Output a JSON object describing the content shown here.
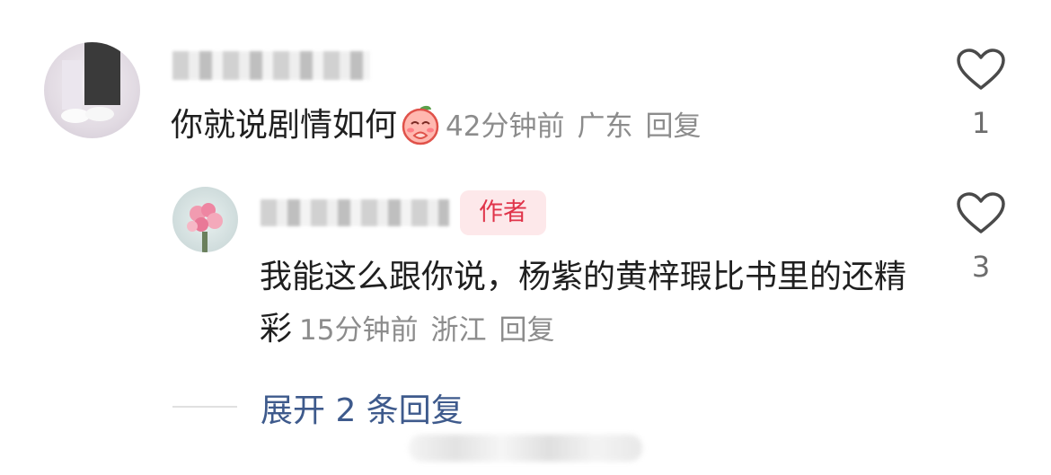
{
  "comments": [
    {
      "text": "你就说剧情如何",
      "emoji": "pleading-peach-emoji",
      "time": "42分钟前",
      "location": "广东",
      "reply_label": "回复",
      "likes": "1"
    },
    {
      "badge": "作者",
      "text": "我能这么跟你说，杨紫的黄梓瑕比书里的还精彩",
      "time": "15分钟前",
      "location": "浙江",
      "reply_label": "回复",
      "likes": "3"
    }
  ],
  "expand_label": "展开 2 条回复",
  "colors": {
    "badge_bg": "#fde8ea",
    "badge_text": "#e0344a",
    "link": "#3e5a8c",
    "meta": "#8c8c8c"
  }
}
